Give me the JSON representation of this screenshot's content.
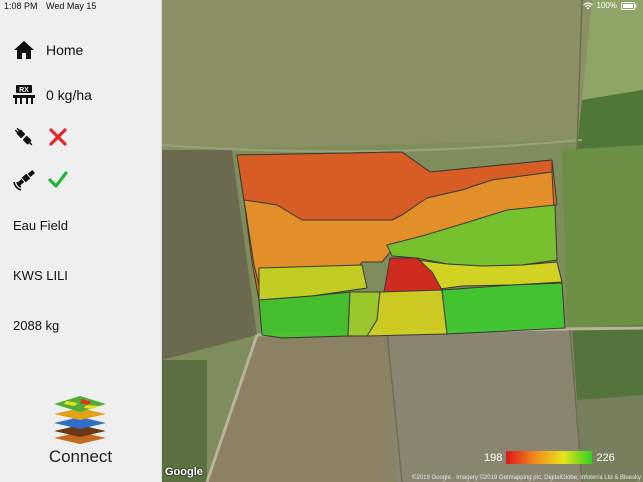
{
  "status": {
    "time": "1:08 PM",
    "date": "Wed May 15",
    "battery": "100%"
  },
  "sidebar": {
    "home_label": "Home",
    "rate_label": "0 kg/ha",
    "rx_badge": "RX",
    "connection_icons": [
      "plug-icon",
      "x-mark-icon"
    ],
    "gps_icons": [
      "satellite-icon",
      "check-mark-icon"
    ],
    "field_name": "Eau Field",
    "variety": "KWS LILI",
    "total_weight": "2088 kg",
    "app_name": "Connect"
  },
  "map": {
    "provider": "Google",
    "copyright": "©2019 Google · Imagery ©2019 Getmapping plc, DigitalGlobe, Infoterra Ltd & Bluesky",
    "legend_min": "198",
    "legend_max": "226",
    "legend_colors": [
      "#e0151c",
      "#f08a1a",
      "#e7e21a",
      "#2fd21f"
    ]
  }
}
